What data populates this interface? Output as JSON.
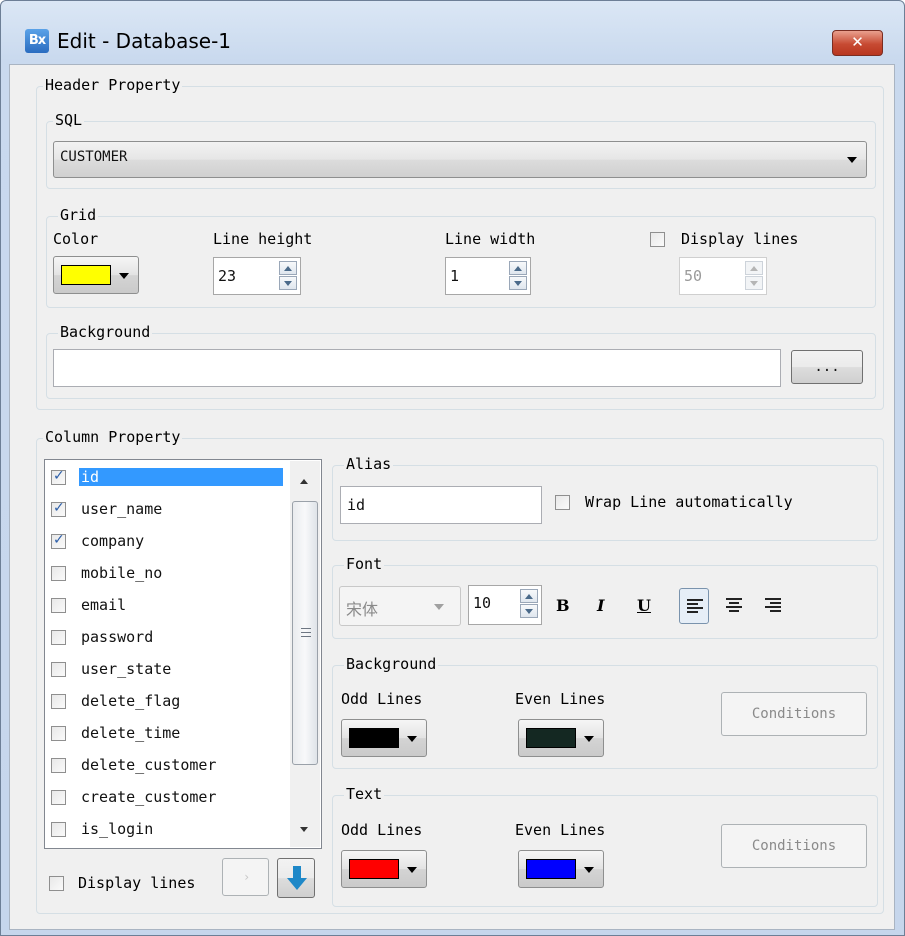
{
  "window": {
    "title": "Edit - Database-1",
    "icon_text": "Bx",
    "close_label": "✕"
  },
  "header_property": {
    "legend": "Header Property",
    "sql": {
      "legend": "SQL",
      "value": "CUSTOMER"
    },
    "grid": {
      "legend": "Grid",
      "color_label": "Color",
      "color": "#ffff00",
      "line_height_label": "Line height",
      "line_height": "23",
      "line_width_label": "Line width",
      "line_width": "1",
      "display_lines_label": "Display lines",
      "display_lines_checked": false,
      "display_lines": "50"
    },
    "background": {
      "legend": "Background",
      "value": "",
      "browse_label": "..."
    }
  },
  "column_property": {
    "legend": "Column Property",
    "columns": [
      {
        "name": "id",
        "checked": true,
        "selected": true
      },
      {
        "name": "user_name",
        "checked": true,
        "selected": false
      },
      {
        "name": "company",
        "checked": true,
        "selected": false
      },
      {
        "name": "mobile_no",
        "checked": false,
        "selected": false
      },
      {
        "name": "email",
        "checked": false,
        "selected": false
      },
      {
        "name": "password",
        "checked": false,
        "selected": false
      },
      {
        "name": "user_state",
        "checked": false,
        "selected": false
      },
      {
        "name": "delete_flag",
        "checked": false,
        "selected": false
      },
      {
        "name": "delete_time",
        "checked": false,
        "selected": false
      },
      {
        "name": "delete_customer",
        "checked": false,
        "selected": false
      },
      {
        "name": "create_customer",
        "checked": false,
        "selected": false
      },
      {
        "name": "is_login",
        "checked": false,
        "selected": false
      }
    ],
    "display_lines_label": "Display lines",
    "alias": {
      "legend": "Alias",
      "value": "id",
      "wrap_label": "Wrap Line automatically",
      "wrap_checked": false
    },
    "font": {
      "legend": "Font",
      "family": "宋体",
      "size": "10",
      "bold": "B",
      "italic": "I",
      "underline": "U"
    },
    "background": {
      "legend": "Background",
      "odd_label": "Odd Lines",
      "odd_color": "#000000",
      "even_label": "Even Lines",
      "even_color": "#142822",
      "conditions_label": "Conditions"
    },
    "text": {
      "legend": "Text",
      "odd_label": "Odd Lines",
      "odd_color": "#ff0000",
      "even_label": "Even Lines",
      "even_color": "#0000ff",
      "conditions_label": "Conditions"
    }
  }
}
